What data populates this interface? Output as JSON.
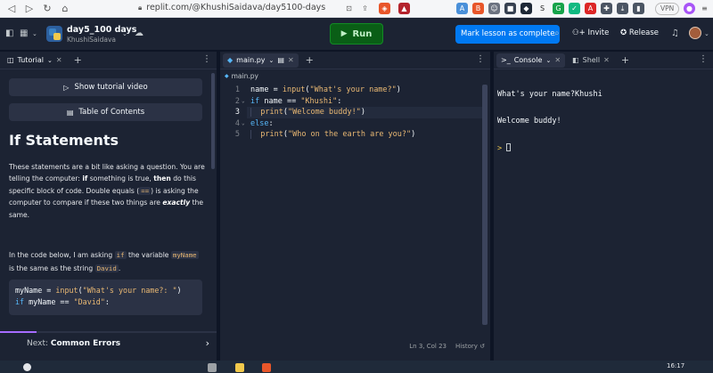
{
  "browser": {
    "url": "replit.com/@KhushiSaidava/day5100-days",
    "vpn_label": "VPN",
    "extensions": [
      {
        "name": "translate-extension",
        "glyph": "A",
        "color": "#4a90d9"
      },
      {
        "name": "brave-shield-extension",
        "glyph": "B",
        "color": "#e8562a"
      },
      {
        "name": "user-extension",
        "glyph": "☺",
        "color": "#6b7280"
      },
      {
        "name": "dark-extension",
        "glyph": "■",
        "color": "#374151"
      },
      {
        "name": "app-extension",
        "glyph": "◆",
        "color": "#1f2937"
      },
      {
        "name": "s-extension",
        "glyph": "S",
        "color": "#f5f6f8"
      },
      {
        "name": "grammarly-extension",
        "glyph": "G",
        "color": "#16a34a"
      },
      {
        "name": "puzzle-extension",
        "glyph": "✓",
        "color": "#10b981"
      },
      {
        "name": "pdf-extension",
        "glyph": "A",
        "color": "#dc2626"
      },
      {
        "name": "extensions-puzzle-extension",
        "glyph": "✚",
        "color": "#4b5563"
      },
      {
        "name": "download-extension",
        "glyph": "⤓",
        "color": "#4b5563"
      },
      {
        "name": "sidebar-extension",
        "glyph": "▮",
        "color": "#4b5563"
      }
    ]
  },
  "header": {
    "repl_name": "day5_100 days",
    "owner": "KhushiSaidava",
    "run_label": "Run",
    "mark_lesson_label": "Mark lesson as complete",
    "invite_label": "Invite",
    "release_label": "Release"
  },
  "tutorial": {
    "tab_label": "Tutorial",
    "show_video_label": "Show tutorial video",
    "toc_label": "Table of Contents",
    "heading": "If Statements",
    "para1": {
      "p1": "These statements are a bit like asking a question. You are telling the computer: ",
      "b1": "if",
      "p2": " something is true, ",
      "b2": "then",
      "p3": " do this specific block of code. Double equals (",
      "code": "==",
      "p4": ") is asking the computer to compare if these two things are ",
      "em": "exactly",
      "p5": " the same."
    },
    "para2": {
      "p1": "In the code below, I am asking ",
      "c1": "if",
      "p2": " the variable ",
      "c2": "myName",
      "p3": " is the same as the string ",
      "c3": "David",
      "p4": "."
    },
    "snippet": {
      "line1_var": "myName = ",
      "line1_fn": "input",
      "line1_str": "\"What's your name?: \"",
      "line1_close": ")",
      "line2_kw": "if",
      "line2_var": " myName == ",
      "line2_str": "\"David\"",
      "line2_close": ":"
    },
    "next_prefix": "Next: ",
    "next_title": "Common Errors",
    "progress_fraction": 0.17
  },
  "editor": {
    "tab_label": "main.py",
    "breadcrumb": "main.py",
    "line_numbers": [
      "1",
      "2",
      "3",
      "4",
      "5"
    ],
    "fold_markers": [
      "",
      "⌄",
      "",
      "⌄",
      ""
    ],
    "current_line": 3,
    "lines": [
      {
        "indent": "",
        "tokens": [
          {
            "t": "name = ",
            "c": "#f5f9fc"
          },
          {
            "t": "input",
            "c": "#e9b873"
          },
          {
            "t": "(",
            "c": "#f5f9fc"
          },
          {
            "t": "\"What's your name?\"",
            "c": "#e9b873"
          },
          {
            "t": ")",
            "c": "#f5f9fc"
          }
        ]
      },
      {
        "indent": "",
        "tokens": [
          {
            "t": "if",
            "c": "#56b6f7"
          },
          {
            "t": " name == ",
            "c": "#f5f9fc"
          },
          {
            "t": "\"Khushi\"",
            "c": "#e9b873"
          },
          {
            "t": ":",
            "c": "#f5f9fc"
          }
        ]
      },
      {
        "indent": "  ",
        "tokens": [
          {
            "t": "print",
            "c": "#e9b873"
          },
          {
            "t": "(",
            "c": "#f5f9fc"
          },
          {
            "t": "\"Welcome buddy!\"",
            "c": "#e9b873"
          },
          {
            "t": ")",
            "c": "#f5f9fc"
          }
        ]
      },
      {
        "indent": "",
        "tokens": [
          {
            "t": "else",
            "c": "#56b6f7"
          },
          {
            "t": ":",
            "c": "#f5f9fc"
          }
        ]
      },
      {
        "indent": "  ",
        "tokens": [
          {
            "t": "print",
            "c": "#e9b873"
          },
          {
            "t": "(",
            "c": "#f5f9fc"
          },
          {
            "t": "\"Who on the earth are you?\"",
            "c": "#e9b873"
          },
          {
            "t": ")",
            "c": "#f5f9fc"
          }
        ]
      }
    ],
    "cursor_position": "Ln 3, Col 23",
    "history_label": "History"
  },
  "console": {
    "console_tab_label": "Console",
    "shell_tab_label": "Shell",
    "output_line1": "What's your name?Khushi",
    "output_line2": "Welcome buddy!",
    "prompt_glyph": ">"
  },
  "taskbar": {
    "time": "16:17"
  }
}
